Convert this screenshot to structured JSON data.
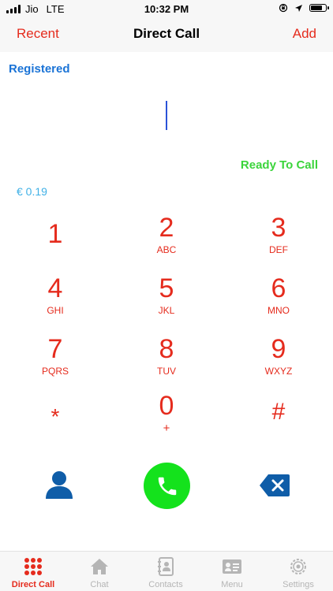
{
  "status_bar": {
    "carrier": "Jio",
    "network": "LTE",
    "time": "10:32 PM",
    "battery_level": 0.85
  },
  "nav": {
    "left_label": "Recent",
    "title": "Direct Call",
    "right_label": "Add"
  },
  "registration_status": "Registered",
  "dial_input": {
    "value": ""
  },
  "call_status": "Ready To Call",
  "balance": "€ 0.19",
  "keypad": [
    {
      "digit": "1",
      "letters": ""
    },
    {
      "digit": "2",
      "letters": "ABC"
    },
    {
      "digit": "3",
      "letters": "DEF"
    },
    {
      "digit": "4",
      "letters": "GHI"
    },
    {
      "digit": "5",
      "letters": "JKL"
    },
    {
      "digit": "6",
      "letters": "MNO"
    },
    {
      "digit": "7",
      "letters": "PQRS"
    },
    {
      "digit": "8",
      "letters": "TUV"
    },
    {
      "digit": "9",
      "letters": "WXYZ"
    },
    {
      "digit": "*",
      "letters": ""
    },
    {
      "digit": "0",
      "letters": "+"
    },
    {
      "digit": "#",
      "letters": ""
    }
  ],
  "tabs": [
    {
      "label": "Direct Call",
      "icon": "keypad-icon",
      "active": true
    },
    {
      "label": "Chat",
      "icon": "home-icon",
      "active": false
    },
    {
      "label": "Contacts",
      "icon": "contacts-book-icon",
      "active": false
    },
    {
      "label": "Menu",
      "icon": "id-card-icon",
      "active": false
    },
    {
      "label": "Settings",
      "icon": "gear-icon",
      "active": false
    }
  ],
  "colors": {
    "accent": "#e52b1d",
    "registered": "#1a73d6",
    "ready": "#3bd43b",
    "balance": "#3fb0e6",
    "call_button": "#14e21c",
    "contact_icon": "#0f5da8",
    "delete_icon": "#0f5da8",
    "tab_inactive": "#b5b5b5"
  }
}
